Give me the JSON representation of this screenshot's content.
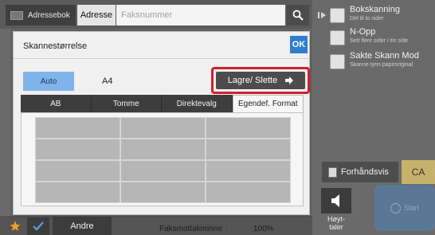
{
  "top_bar": {
    "address_book_label": "Adressebok",
    "address_label": "Adresse",
    "fax_number_placeholder": "Faksnummer"
  },
  "right_panel": {
    "options": [
      {
        "title": "Bokskanning",
        "subtitle": "Del til to sider"
      },
      {
        "title": "N-Opp",
        "subtitle": "Sett flere sider i én side"
      },
      {
        "title": "Sakte Skann Mod",
        "subtitle": "Skanne tynn papiroriginal"
      }
    ],
    "preview_label": "Forhåndsvis",
    "ca_label": "CA",
    "speaker_label": "Høyt-\ntaler",
    "start_label": "Start"
  },
  "bottom_bar": {
    "other_label": "Andre",
    "memory_label": "Faksmottakminne",
    "memory_colon": ":",
    "memory_value": "100%"
  },
  "dialog": {
    "title": "Skannestørrelse",
    "ok_label": "OK",
    "auto_label": "Auto",
    "size_value": "A4",
    "save_delete_label": "Lagre/ Slette",
    "tabs": [
      {
        "label": "AB",
        "active": false
      },
      {
        "label": "Tomme",
        "active": false
      },
      {
        "label": "Direktevalg",
        "active": false
      },
      {
        "label": "Egendef. Format",
        "active": true
      }
    ]
  },
  "colors": {
    "accent_blue": "#2f7fd0",
    "auto_selected": "#7fb4ea",
    "highlight_red": "#d2202a",
    "ca_button": "#c6b26a",
    "start_button": "#5a7896"
  }
}
